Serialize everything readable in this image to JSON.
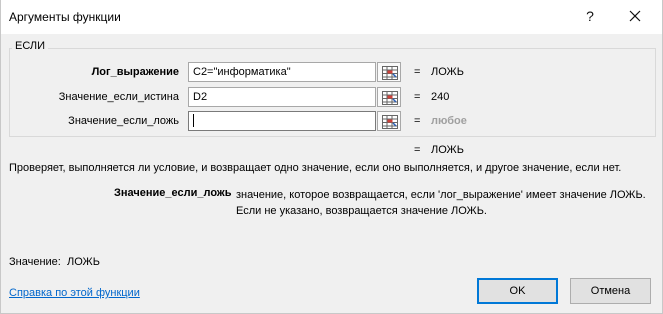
{
  "window": {
    "title": "Аргументы функции",
    "help_glyph": "?",
    "close_glyph": "✕"
  },
  "function": {
    "name": "ЕСЛИ",
    "args": [
      {
        "label": "Лог_выражение",
        "value": "C2=\"информатика\"",
        "result": "ЛОЖЬ",
        "bold": true
      },
      {
        "label": "Значение_если_истина",
        "value": "D2",
        "result": "240",
        "bold": false
      },
      {
        "label": "Значение_если_ложь",
        "value": "",
        "result": "любое",
        "bold": false
      }
    ],
    "eq_sign": "=",
    "overall_result": "ЛОЖЬ"
  },
  "description": "Проверяет, выполняется ли условие, и возвращает одно значение, если оно выполняется, и другое значение, если нет.",
  "current_arg": {
    "name": "Значение_если_ложь",
    "description": "значение, которое возвращается, если 'лог_выражение' имеет значение ЛОЖЬ. Если не указано, возвращается значение ЛОЖЬ."
  },
  "value": {
    "label": "Значение:",
    "result": "ЛОЖЬ"
  },
  "help_link": "Справка по этой функции",
  "buttons": {
    "ok": "OK",
    "cancel": "Отмена"
  },
  "colors": {
    "accent": "#0078d7",
    "link": "#0066cc",
    "muted_result": "#a0a0a0"
  }
}
